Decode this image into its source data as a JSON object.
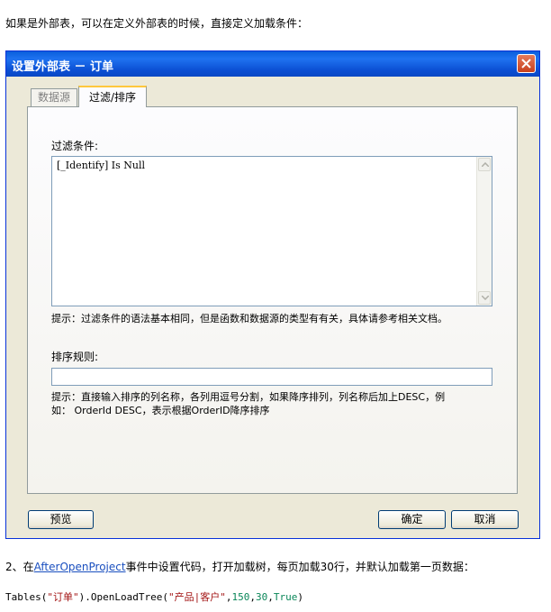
{
  "intro_text": "如果是外部表，可以在定义外部表的时候，直接定义加载条件：",
  "dialog": {
    "title": "设置外部表 － 订单",
    "tabs": [
      "数据源",
      "过滤/排序"
    ],
    "filter_label": "过滤条件:",
    "filter_value": "[_Identify] Is Null",
    "filter_hint": "提示：过滤条件的语法基本相同，但是函数和数据源的类型有有关，具体请参考相关文档。",
    "sort_label": "排序规则:",
    "sort_value": "",
    "sort_hint_line1": "提示：直接输入排序的列名称，各列用逗号分割，如果降序排列，列名称后加上DESC，例",
    "sort_hint_line2": "如： OrderId DESC，表示根据OrderID降序排序",
    "buttons": {
      "preview": "预览",
      "ok": "确定",
      "cancel": "取消"
    }
  },
  "step2": {
    "prefix": "2、在",
    "link": "AfterOpenProject",
    "suffix": "事件中设置代码，打开加载树，每页加载30行，并默认加载第一页数据："
  },
  "code": {
    "part1": "Tables(",
    "str1": "\"订单\"",
    "part2": ").OpenLoadTree(",
    "str2": "\"产品|客户\"",
    "comma1": ",",
    "num1": "150",
    "comma2": ",",
    "num2": "30",
    "comma3": ",",
    "bool": "True",
    "part3": ")"
  },
  "colors": {
    "titlebar": "#0a5fdc",
    "dialog_bg": "#ece9d8",
    "link": "#1a4fbf"
  }
}
